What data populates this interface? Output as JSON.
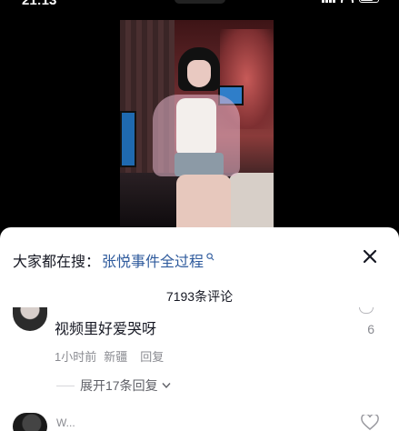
{
  "status_bar": {
    "time": "21:13"
  },
  "colors": {
    "link": "#2f5b9d",
    "text": "#161823",
    "muted": "#8a8b91",
    "sheet_bg": "#ffffff"
  },
  "sheet": {
    "search_hint_prefix": "大家都在搜：",
    "search_hint_link": "张悦事件全过程",
    "close_icon": "close-icon",
    "comment_count": "7193条评论"
  },
  "comments": [
    {
      "text": "视频里好爱哭呀",
      "time": "1小时前",
      "location": "新疆",
      "reply_label": "回复",
      "like_count": "6",
      "expand_label": "展开17条回复"
    },
    {
      "username": "W..."
    }
  ]
}
